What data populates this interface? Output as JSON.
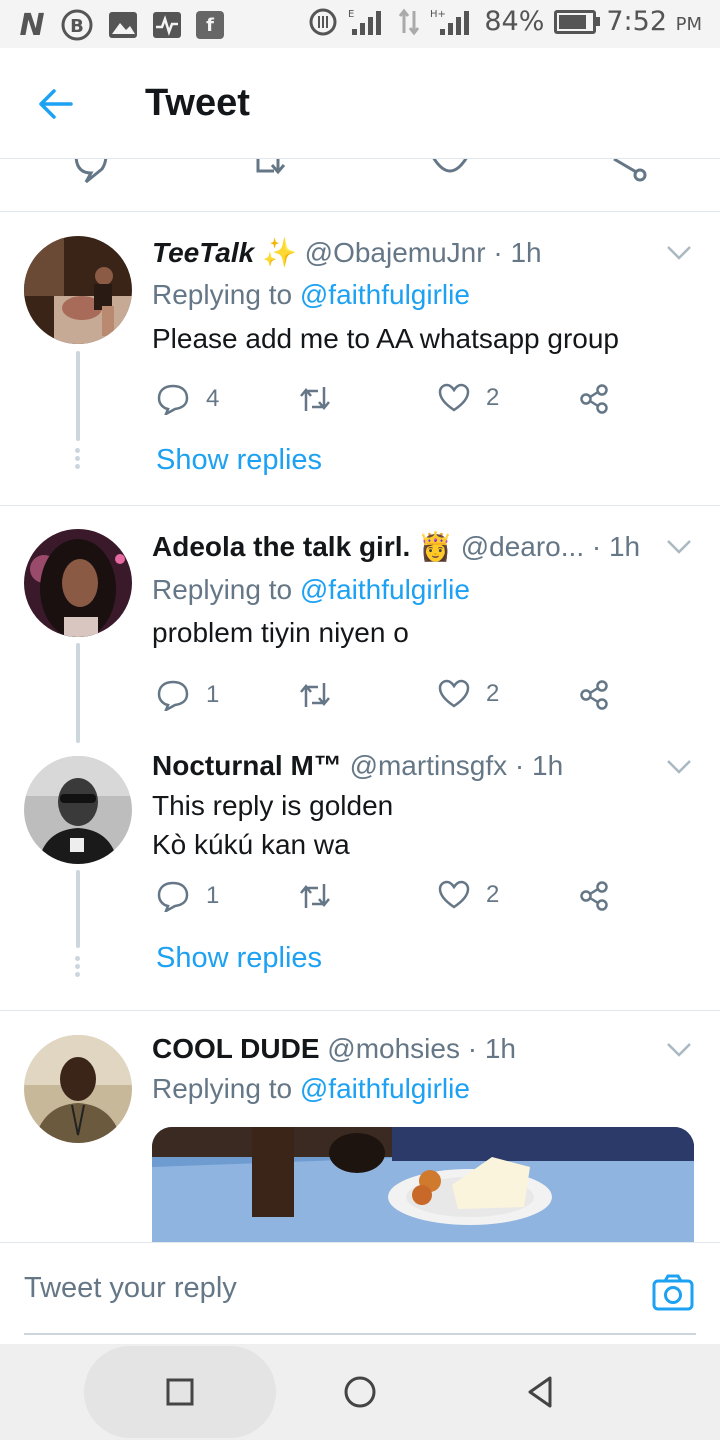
{
  "status_bar": {
    "battery_pct": "84%",
    "battery_level": 0.84,
    "time": "7:52",
    "time_suffix": "PM",
    "net_label": "H+"
  },
  "header": {
    "title": "Tweet"
  },
  "tweets": [
    {
      "name": "TeeTalk",
      "name_emoji": "✨",
      "handle": "@ObajemuJnr · 1h",
      "replying_prefix": "Replying to",
      "replying_to": "@faithfulgirlie",
      "text": "Please add me to AA whatsapp group",
      "replies": "4",
      "retweets": "",
      "likes": "2",
      "show_replies": "Show replies"
    },
    {
      "name": "Adeola the talk girl.",
      "name_emoji": "👸",
      "handle": "@dearo...",
      "time": "· 1h",
      "replying_prefix": "Replying to",
      "replying_to": "@faithfulgirlie",
      "text": "problem tiyin niyen o",
      "replies": "1",
      "retweets": "",
      "likes": "2"
    },
    {
      "name": "Nocturnal M™",
      "handle": "@martinsgfx · 1h",
      "text_line1": "This reply is golden",
      "text_line2": "Kò kúkú kan wa",
      "replies": "1",
      "retweets": "",
      "likes": "2",
      "show_replies": "Show replies"
    },
    {
      "name": "COOL DUDE",
      "handle": "@mohsies · 1h",
      "replying_prefix": "Replying to",
      "replying_to": "@faithfulgirlie"
    }
  ],
  "composer": {
    "placeholder": "Tweet your reply"
  },
  "colors": {
    "accent": "#1da1f2",
    "secondary_text": "#657786",
    "divider": "#e1e8ed"
  }
}
